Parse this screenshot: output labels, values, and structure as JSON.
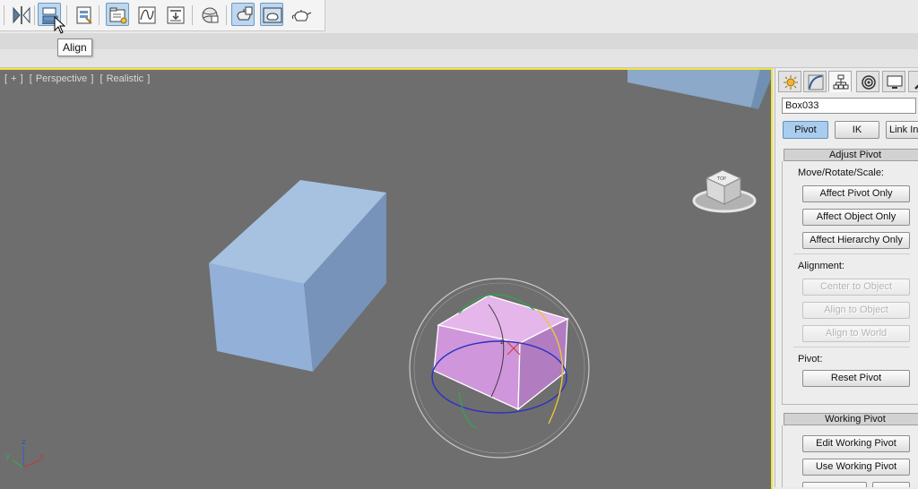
{
  "toolbar": {
    "tooltip": "Align",
    "buttons": [
      {
        "icon": "mirror-icon",
        "active": false
      },
      {
        "icon": "align-icon",
        "active": true
      },
      {
        "icon": "layer-manager-icon",
        "active": false
      },
      {
        "icon": "scene-explorer-icon",
        "active": false
      },
      {
        "icon": "curve-editor-icon",
        "active": false
      },
      {
        "icon": "schematic-view-icon",
        "active": false
      },
      {
        "icon": "material-editor-icon",
        "active": false
      },
      {
        "icon": "render-setup-icon",
        "active": false
      },
      {
        "icon": "rendered-frame-icon",
        "active": false
      },
      {
        "icon": "render-teapot-icon",
        "active": false
      }
    ]
  },
  "viewport": {
    "label_plus": "[ + ]",
    "label_view": "[ Perspective ]",
    "label_shading": "[ Realistic ]",
    "viewcube_text": "TOP",
    "gizmo_label": "z",
    "axes": {
      "x": "x",
      "y": "y",
      "z": "z"
    },
    "colors": {
      "box_blue": "#8fb0d6",
      "box_selected": "#d9a0e2",
      "active_border": "#f2e33a"
    }
  },
  "panel": {
    "tabs": [
      "create-tab",
      "modify-tab",
      "hierarchy-tab",
      "motion-tab",
      "display-tab",
      "utilities-tab"
    ],
    "object_name": "Box033",
    "mode_buttons": {
      "pivot": "Pivot",
      "ik": "IK",
      "link_info": "Link Info"
    },
    "adjust_pivot": {
      "title": "Adjust Pivot",
      "toggle": "−",
      "move_rotate_scale_label": "Move/Rotate/Scale:",
      "affect_pivot_only": "Affect Pivot Only",
      "affect_object_only": "Affect Object Only",
      "affect_hierarchy_only": "Affect Hierarchy Only",
      "alignment_label": "Alignment:",
      "center_to_object": "Center to Object",
      "align_to_object": "Align to Object",
      "align_to_world": "Align to World",
      "pivot_label": "Pivot:",
      "reset_pivot": "Reset Pivot"
    },
    "working_pivot": {
      "title": "Working Pivot",
      "toggle": "−",
      "edit_working_pivot": "Edit Working Pivot",
      "use_working_pivot": "Use Working Pivot"
    }
  }
}
